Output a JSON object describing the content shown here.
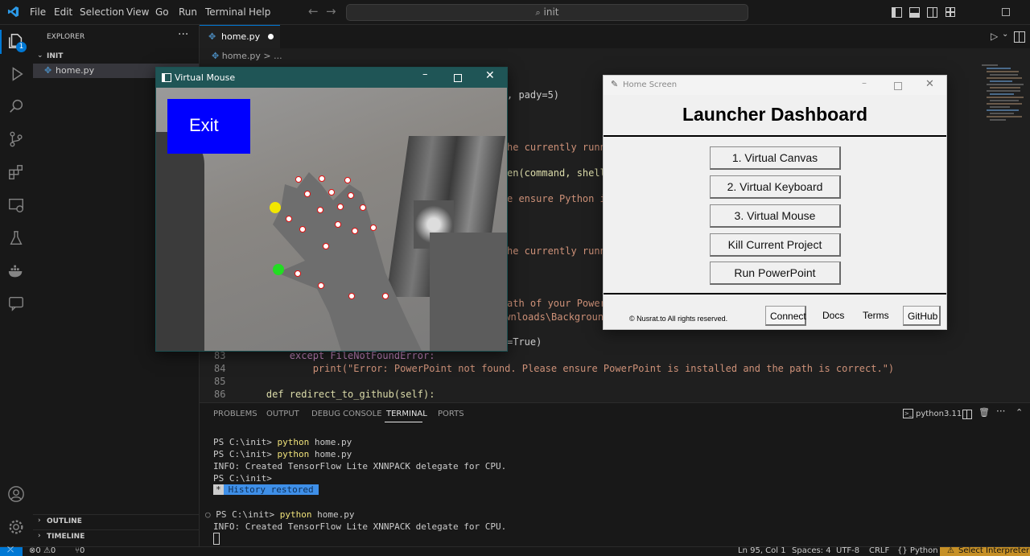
{
  "menu": [
    "File",
    "Edit",
    "Selection",
    "View",
    "Go",
    "Run",
    "Terminal",
    "Help"
  ],
  "command_center": {
    "placeholder": "init"
  },
  "activity_badge": "1",
  "explorer": {
    "title": "EXPLORER",
    "folder": "INIT",
    "file": "home.py",
    "outline": "OUTLINE",
    "timeline": "TIMELINE"
  },
  "tab": {
    "name": "home.py"
  },
  "breadcrumb": {
    "file": "home.py",
    "sep": ">",
    "more": "..."
  },
  "code_fragments": {
    "l1": ", pady=5)",
    "l2": "he currently runnin",
    "l3": "en(command, shell=T",
    "l4": "e ensure Python is",
    "l5": "he currently runnin",
    "l6": "ath of your PowerPo",
    "l7": "ownloads\\Backgroun",
    "l8": "=True)"
  },
  "code_lines": [
    {
      "num": "83",
      "text": "        except FileNotFoundError:"
    },
    {
      "num": "84",
      "text": "            print(\"Error: PowerPoint not found. Please ensure PowerPoint is installed and the path is correct.\")"
    },
    {
      "num": "85",
      "text": ""
    },
    {
      "num": "86",
      "text": "    def redirect_to_github(self):"
    }
  ],
  "panel_tabs": [
    "PROBLEMS",
    "OUTPUT",
    "DEBUG CONSOLE",
    "TERMINAL",
    "PORTS"
  ],
  "terminal_profile": "python3.11",
  "terminal": {
    "prompt": "PS C:\\init>",
    "cmd": "python",
    "arg": "home.py",
    "info": "INFO: Created TensorFlow Lite XNNPACK delegate for CPU.",
    "history_mark": "*",
    "history": "History restored",
    "bullet": "○"
  },
  "status": {
    "errors": "0",
    "warnings": "0",
    "ports": "0",
    "position": "Ln 95, Col 1",
    "spaces": "Spaces: 4",
    "encoding": "UTF-8",
    "eol": "CRLF",
    "language": "Python",
    "interpreter": "Select Interpreter"
  },
  "virtual_mouse": {
    "title": "Virtual Mouse",
    "exit_label": "Exit"
  },
  "home_screen": {
    "title": "Home Screen",
    "heading": "Launcher Dashboard",
    "buttons": [
      "1. Virtual Canvas",
      "2. Virtual Keyboard",
      "3. Virtual Mouse",
      "Kill Current Project",
      "Run PowerPoint"
    ],
    "copyright": "© Nusrat.to All rights reserved.",
    "links": [
      "Connect",
      "Docs",
      "Terms",
      "GitHub"
    ]
  },
  "colors": {
    "accent": "#0078d4",
    "exit_bg": "#0000ff",
    "yellow_dot": "#f2e600",
    "green_dot": "#22dd22",
    "status_interpreter": "#c69026"
  }
}
